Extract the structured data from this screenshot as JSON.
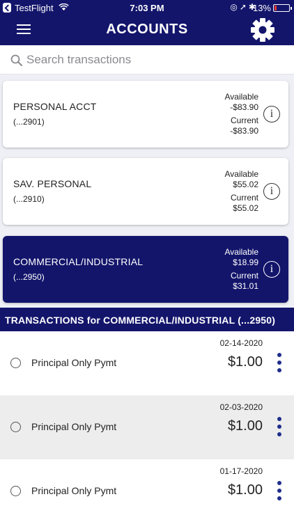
{
  "status_bar": {
    "carrier": "TestFlight",
    "time": "7:03 PM",
    "battery": "13%"
  },
  "nav": {
    "title": "ACCOUNTS"
  },
  "search": {
    "placeholder": "Search transactions"
  },
  "accounts": [
    {
      "name": "PERSONAL ACCT",
      "number": "(...2901)",
      "available_label": "Available",
      "available": "-$83.90",
      "current_label": "Current",
      "current": "-$83.90",
      "selected": false
    },
    {
      "name": "SAV. PERSONAL",
      "number": "(...2910)",
      "available_label": "Available",
      "available": "$55.02",
      "current_label": "Current",
      "current": "$55.02",
      "selected": false
    },
    {
      "name": "COMMERCIAL/INDUSTRIAL",
      "number": "(...2950)",
      "available_label": "Available",
      "available": "$18.99",
      "current_label": "Current",
      "current": "$31.01",
      "selected": true
    }
  ],
  "transactions": {
    "header": "TRANSACTIONS for COMMERCIAL/INDUSTRIAL (...2950)",
    "items": [
      {
        "date": "02-14-2020",
        "description": "Principal Only Pymt",
        "amount": "$1.00"
      },
      {
        "date": "02-03-2020",
        "description": "Principal Only Pymt",
        "amount": "$1.00"
      },
      {
        "date": "01-17-2020",
        "description": "Principal Only Pymt",
        "amount": "$1.00"
      }
    ]
  },
  "colors": {
    "brand_navy": "#13156b",
    "kebab_blue": "#1f2e8a"
  },
  "icons": {
    "back": "back-to-app-icon",
    "wifi": "wifi-icon",
    "menu": "hamburger-menu-icon",
    "settings": "gear-icon",
    "search": "search-icon",
    "info": "info-icon",
    "more": "more-vertical-icon",
    "radio": "radio-unchecked-icon",
    "battery": "battery-icon"
  }
}
